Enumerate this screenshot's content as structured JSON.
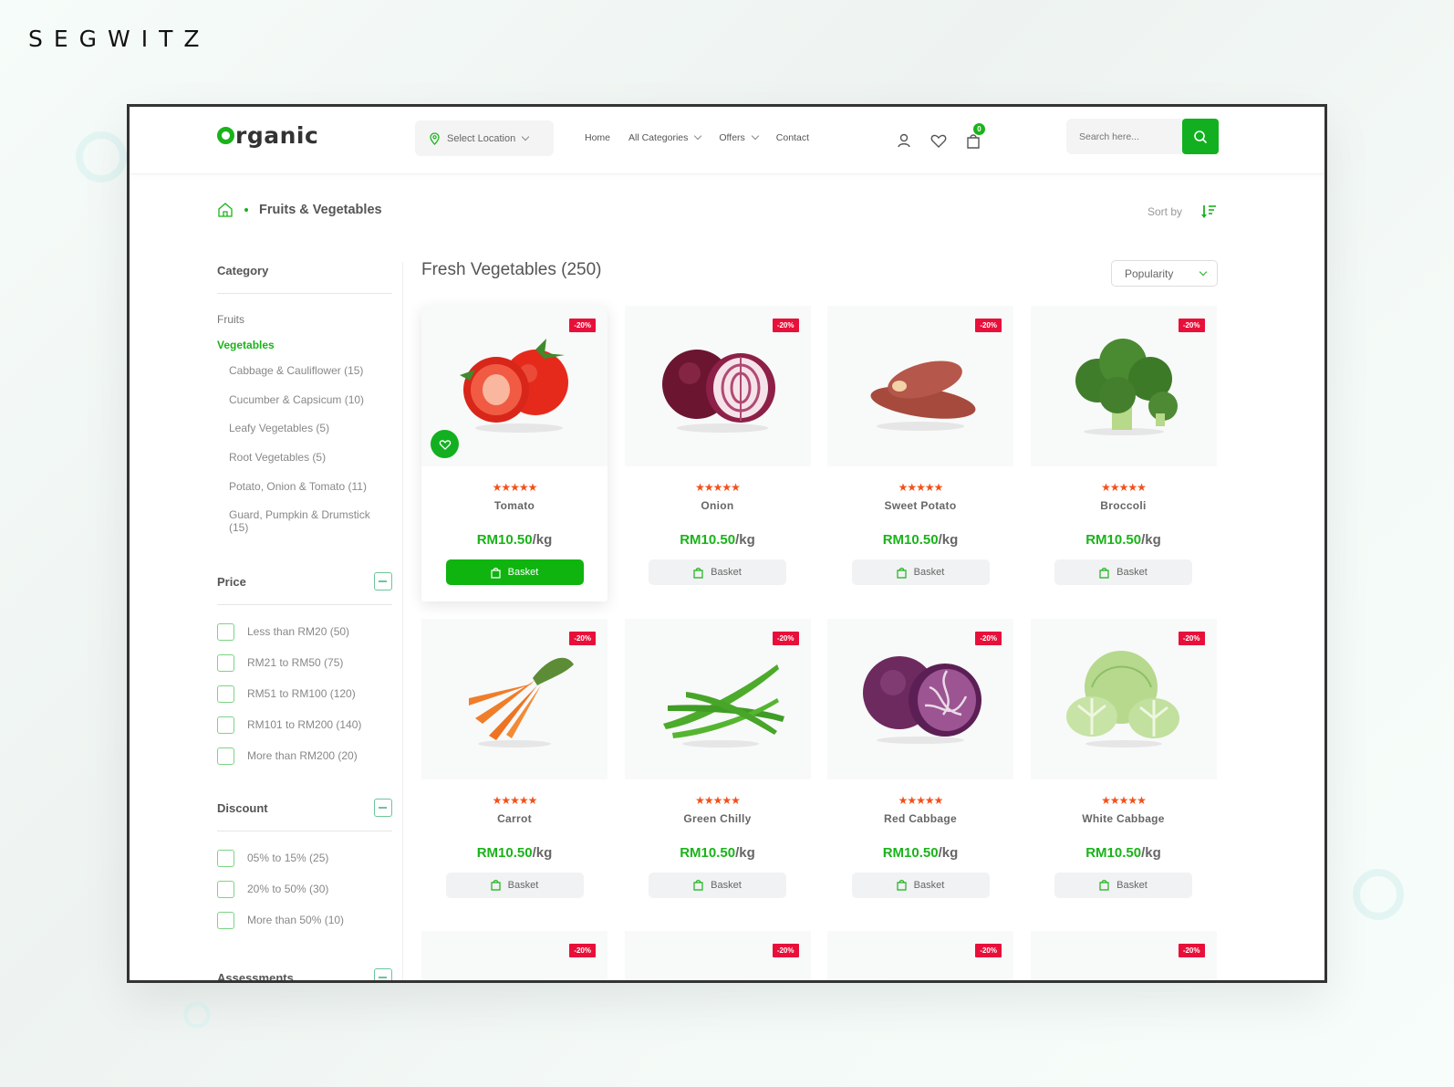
{
  "brand": "SEGWITZ",
  "header": {
    "logo_rest": "rganic",
    "location_label": "Select Location",
    "nav": [
      {
        "label": "Home",
        "dropdown": false
      },
      {
        "label": "All Categories",
        "dropdown": true
      },
      {
        "label": "Offers",
        "dropdown": true
      },
      {
        "label": "Contact",
        "dropdown": false
      }
    ],
    "cart_count": "0",
    "search_placeholder": "Search here..."
  },
  "breadcrumb": {
    "current": "Fruits & Vegetables"
  },
  "sort": {
    "label": "Sort by",
    "selected": "Popularity"
  },
  "sidebar": {
    "category_title": "Category",
    "categories": [
      {
        "label": "Fruits",
        "active": false
      },
      {
        "label": "Vegetables",
        "active": true
      }
    ],
    "subcategories": [
      "Cabbage & Cauliflower (15)",
      "Cucumber & Capsicum (10)",
      "Leafy Vegetables (5)",
      "Root Vegetables (5)",
      "Potato, Onion & Tomato (11)",
      "Guard, Pumpkin & Drumstick (15)"
    ],
    "price_title": "Price",
    "price_options": [
      "Less than RM20 (50)",
      "RM21 to RM50 (75)",
      "RM51 to RM100 (120)",
      "RM101 to RM200 (140)",
      "More than RM200 (20)"
    ],
    "discount_title": "Discount",
    "discount_options": [
      "05% to 15% (25)",
      "20% to 50% (30)",
      "More than 50% (10)"
    ],
    "assessments_title": "Assessments"
  },
  "main": {
    "title": "Fresh Vegetables (250)",
    "basket_label": "Basket",
    "products": [
      {
        "name": "Tomato",
        "price": "RM10.50",
        "unit": "/kg",
        "discount": "-20%",
        "rating": 5,
        "image": "tomato",
        "highlighted": true
      },
      {
        "name": "Onion",
        "price": "RM10.50",
        "unit": "/kg",
        "discount": "-20%",
        "rating": 5,
        "image": "onion",
        "highlighted": false
      },
      {
        "name": "Sweet Potato",
        "price": "RM10.50",
        "unit": "/kg",
        "discount": "-20%",
        "rating": 5,
        "image": "sweet-potato",
        "highlighted": false
      },
      {
        "name": "Broccoli",
        "price": "RM10.50",
        "unit": "/kg",
        "discount": "-20%",
        "rating": 5,
        "image": "broccoli",
        "highlighted": false
      },
      {
        "name": "Carrot",
        "price": "RM10.50",
        "unit": "/kg",
        "discount": "-20%",
        "rating": 5,
        "image": "carrot",
        "highlighted": false
      },
      {
        "name": "Green Chilly",
        "price": "RM10.50",
        "unit": "/kg",
        "discount": "-20%",
        "rating": 5,
        "image": "green-chilly",
        "highlighted": false
      },
      {
        "name": "Red Cabbage",
        "price": "RM10.50",
        "unit": "/kg",
        "discount": "-20%",
        "rating": 5,
        "image": "red-cabbage",
        "highlighted": false
      },
      {
        "name": "White Cabbage",
        "price": "RM10.50",
        "unit": "/kg",
        "discount": "-20%",
        "rating": 5,
        "image": "white-cabbage",
        "highlighted": false
      }
    ],
    "partial_row_discounts": [
      "-20%",
      "-20%",
      "-20%",
      "-20%"
    ]
  },
  "colors": {
    "accent": "#12b020",
    "discount": "#e8103a",
    "star": "#f2511a"
  }
}
